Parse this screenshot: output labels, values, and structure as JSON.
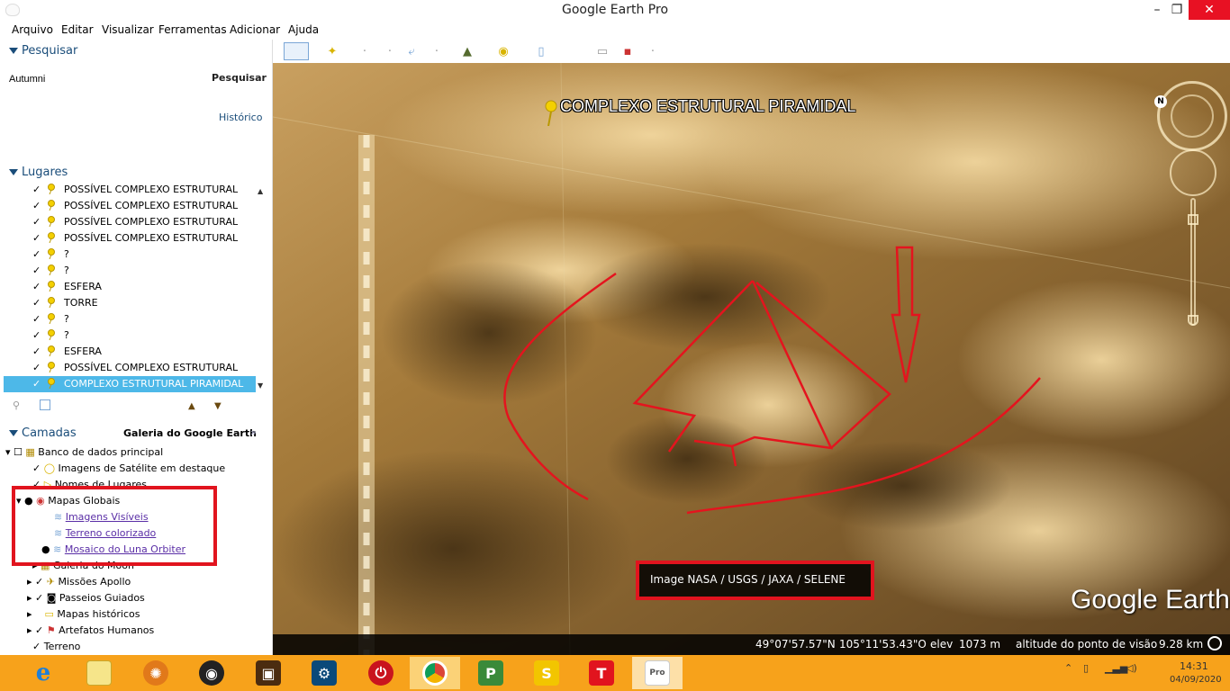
{
  "window": {
    "title": "Google Earth Pro",
    "minimize": "–",
    "restore": "❐",
    "close": "✕"
  },
  "menu": [
    "Arquivo",
    "Editar",
    "Visualizar",
    "Ferramentas",
    "Adicionar",
    "Ajuda"
  ],
  "search": {
    "header": "Pesquisar",
    "value": "Autumni",
    "button": "Pesquisar",
    "history": "Histórico"
  },
  "places": {
    "header": "Lugares",
    "items": [
      {
        "label": "POSSÍVEL COMPLEXO ESTRUTURAL"
      },
      {
        "label": "POSSÍVEL COMPLEXO ESTRUTURAL"
      },
      {
        "label": "POSSÍVEL COMPLEXO ESTRUTURAL"
      },
      {
        "label": "POSSÍVEL COMPLEXO ESTRUTURAL"
      },
      {
        "label": "?"
      },
      {
        "label": "?"
      },
      {
        "label": "ESFERA"
      },
      {
        "label": "TORRE"
      },
      {
        "label": "?"
      },
      {
        "label": "?"
      },
      {
        "label": "ESFERA"
      },
      {
        "label": "POSSÍVEL COMPLEXO ESTRUTURAL"
      },
      {
        "label": "COMPLEXO ESTRUTURAL PIRAMIDAL"
      }
    ]
  },
  "layers": {
    "header": "Camadas",
    "gallery": "Galeria do Google Earth",
    "items": [
      {
        "label": "Banco de dados principal"
      },
      {
        "label": "Imagens de Satélite em destaque"
      },
      {
        "label": "Nomes de Lugares"
      },
      {
        "label": "Mapas Globais"
      },
      {
        "label": "Imagens Visíveis"
      },
      {
        "label": "Terreno colorizado"
      },
      {
        "label": "Mosaico do Luna Orbiter"
      },
      {
        "label": "Galeria do Moon"
      },
      {
        "label": "Missões Apollo"
      },
      {
        "label": "Passeios Guiados"
      },
      {
        "label": "Mapas históricos"
      },
      {
        "label": "Artefatos Humanos"
      },
      {
        "label": "Terreno"
      }
    ]
  },
  "map": {
    "placemark_label": "COMPLEXO ESTRUTURAL PIRAMIDAL",
    "attribution": "Image NASA / USGS / JAXA / SELENE",
    "logo": "Google Earth",
    "compass_letter": "N"
  },
  "status": {
    "lat": "49°07'57.57\"N",
    "lon": "105°11'53.43\"O",
    "elev_label": "elev",
    "elev": "1073 m",
    "eye_label": "altitude do ponto de visão",
    "eye": "9.28 km"
  },
  "taskbar": {
    "apps": [
      "internet-explorer",
      "file-explorer",
      "sd-maid",
      "media-player",
      "photo-app",
      "settings-app",
      "power-app",
      "chrome",
      "publisher",
      "sway",
      "t-app",
      "google-earth-pro"
    ],
    "time": "14:31",
    "date": "04/09/2020"
  }
}
